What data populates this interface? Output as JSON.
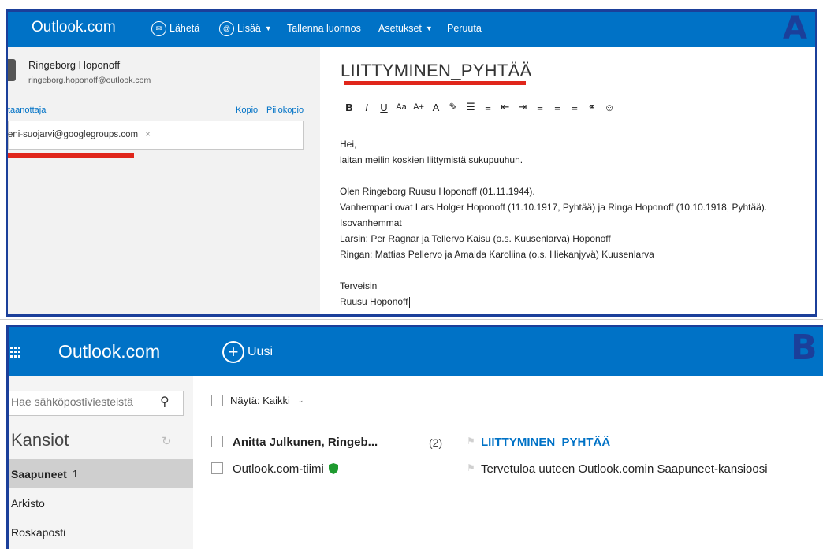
{
  "panel_a": {
    "letter": "A",
    "brand": "Outlook.com",
    "toolbar": {
      "send_label": "Lähetä",
      "more_label": "Lisää",
      "save_draft_label": "Tallenna luonnos",
      "settings_label": "Asetukset",
      "cancel_label": "Peruuta"
    },
    "sender": {
      "name": "Ringeborg Hoponoff",
      "email": "ringeborg.hoponoff@outlook.com"
    },
    "to_label": "taanottaja",
    "cc_label": "Kopio",
    "bcc_label": "Piilokopio",
    "recipient": "eni-suojarvi@googlegroups.com",
    "recipient_remove": "×",
    "subject": "LIITTYMINEN_PYHTÄÄ",
    "format_buttons": [
      {
        "icon": "bold-icon",
        "glyph": "B"
      },
      {
        "icon": "italic-icon",
        "glyph": "I"
      },
      {
        "icon": "underline-icon",
        "glyph": "U"
      },
      {
        "icon": "font-size-icon",
        "glyph": "Aa"
      },
      {
        "icon": "grow-font-icon",
        "glyph": "A+"
      },
      {
        "icon": "font-color-icon",
        "glyph": "A"
      },
      {
        "icon": "highlight-icon",
        "glyph": "✎"
      },
      {
        "icon": "numbered-list-icon",
        "glyph": "☰"
      },
      {
        "icon": "bullet-list-icon",
        "glyph": "≡"
      },
      {
        "icon": "decrease-indent-icon",
        "glyph": "⇤"
      },
      {
        "icon": "increase-indent-icon",
        "glyph": "⇥"
      },
      {
        "icon": "align-left-icon",
        "glyph": "≡"
      },
      {
        "icon": "align-center-icon",
        "glyph": "≡"
      },
      {
        "icon": "align-right-icon",
        "glyph": "≡"
      },
      {
        "icon": "link-icon",
        "glyph": "⚭"
      },
      {
        "icon": "emoji-icon",
        "glyph": "☺"
      }
    ],
    "body_lines": [
      "Hei,",
      "laitan meilin koskien liittymistä sukupuuhun.",
      "",
      "Olen Ringeborg Ruusu Hoponoff (01.11.1944).",
      "Vanhempani ovat Lars Holger Hoponoff (11.10.1917, Pyhtää) ja Ringa Hoponoff (10.10.1918, Pyhtää).",
      "Isovanhemmat",
      "Larsin: Per Ragnar  ja Tellervo Kaisu (o.s. Kuusenlarva) Hoponoff",
      "Ringan: Mattias Pellervo ja Amalda Karoliina (o.s. Hiekanjyvä) Kuusenlarva",
      "",
      "Terveisin",
      "Ruusu Hoponoff"
    ]
  },
  "panel_b": {
    "letter": "B",
    "brand": "Outlook.com",
    "new_label": "Uusi",
    "search_placeholder": "Hae sähköpostiviesteistä",
    "folders_heading": "Kansiot",
    "folders": [
      {
        "label": "Saapuneet",
        "count": "1",
        "selected": true
      },
      {
        "label": "Arkisto",
        "count": "",
        "selected": false
      },
      {
        "label": "Roskaposti",
        "count": "",
        "selected": false
      }
    ],
    "filter_label": "Näytä: Kaikki",
    "messages": [
      {
        "sender": "Anitta Julkunen, Ringeb...",
        "count": "(2)",
        "subject": "LIITTYMINEN_PYHTÄÄ",
        "unread": true,
        "verified": false
      },
      {
        "sender": "Outlook.com-tiimi",
        "count": "",
        "subject": "Tervetuloa uuteen Outlook.comin Saapuneet-kansioosi",
        "unread": false,
        "verified": true
      }
    ]
  },
  "colors": {
    "brand_blue": "#0072c6",
    "frame_blue": "#1b3f9a",
    "annotation_red": "#e0261b",
    "verified_green": "#1e9a2f"
  }
}
